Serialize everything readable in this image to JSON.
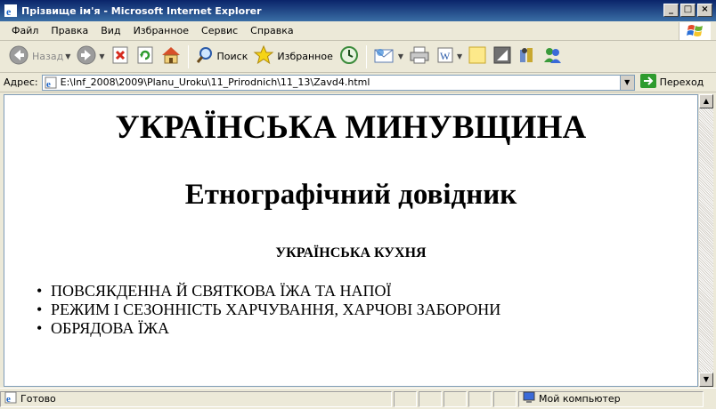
{
  "window": {
    "title": "Прізвище ім'я - Microsoft Internet Explorer",
    "controls": [
      "_",
      "□",
      "×"
    ]
  },
  "menu": {
    "items": [
      "Файл",
      "Правка",
      "Вид",
      "Избранное",
      "Сервис",
      "Справка"
    ]
  },
  "toolbar": {
    "back_label": "Назад",
    "search_label": "Поиск",
    "favorites_label": "Избранное",
    "icons": [
      "back-icon",
      "forward-icon",
      "stop-icon",
      "refresh-icon",
      "home-icon",
      "search-icon",
      "favorites-icon",
      "history-icon",
      "mail-icon",
      "print-icon",
      "edit-icon",
      "discuss-icon",
      "messenger-icon"
    ]
  },
  "address": {
    "label": "Адрес:",
    "value": "E:\\Inf_2008\\2009\\Planu_Uroku\\11_Prirodnich\\11_13\\Zavd4.html",
    "go_label": "Переход"
  },
  "page": {
    "heading": "УКРАЇНСЬКА МИНУВЩИНА",
    "subheading": "Етнографічний довідник",
    "section_title": "УКРАЇНСЬКА КУХНЯ",
    "list": [
      "ПОВСЯКДЕННА Й СВЯТКОВА ЇЖА ТА НАПОЇ",
      "РЕЖИМ І СЕЗОННІСТЬ ХАРЧУВАННЯ, ХАРЧОВІ ЗАБОРОНИ",
      "ОБРЯДОВА ЇЖА"
    ]
  },
  "status": {
    "text": "Готово",
    "zone": "Мой компьютер"
  },
  "colors": {
    "titlebar": "#0a246a",
    "chrome": "#ece9d8",
    "content_bg": "#ffffff"
  }
}
